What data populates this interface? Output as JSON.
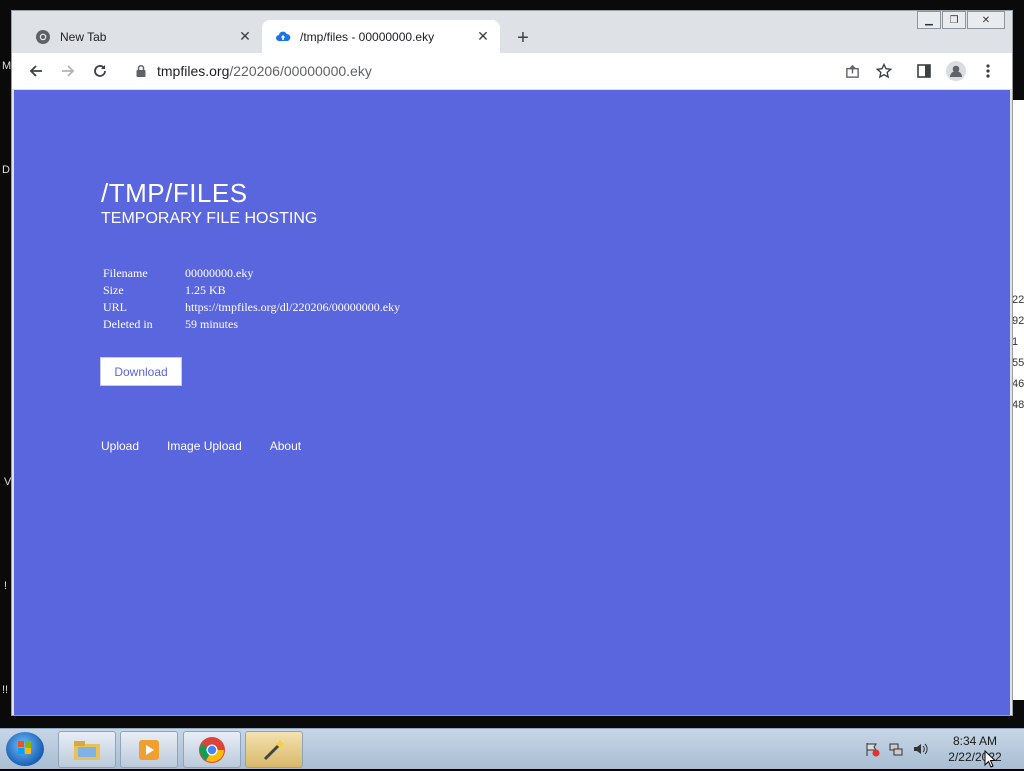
{
  "browser": {
    "tabs": [
      {
        "title": "New Tab",
        "icon": "chrome-icon"
      },
      {
        "title": "/tmp/files - 00000000.eky",
        "icon": "cloud-upload-icon",
        "active": true
      }
    ],
    "url_host": "tmpfiles.org",
    "url_path": "/220206/00000000.eky"
  },
  "page": {
    "site_title": "/TMP/FILES",
    "site_subtitle": "TEMPORARY FILE HOSTING",
    "info": [
      {
        "label": "Filename",
        "value": "00000000.eky"
      },
      {
        "label": "Size",
        "value": "1.25 KB"
      },
      {
        "label": "URL",
        "value": "https://tmpfiles.org/dl/220206/00000000.eky"
      },
      {
        "label": "Deleted in",
        "value": "59 minutes"
      }
    ],
    "download_label": "Download",
    "links": [
      "Upload",
      "Image Upload",
      "About"
    ],
    "background_color": "#5966de"
  },
  "desktop": {
    "left_fragments": [
      "M",
      "D",
      "V",
      "!",
      "!!"
    ],
    "right_fragments": [
      "22",
      "92",
      "1",
      "55",
      "46",
      "48"
    ]
  },
  "taskbar": {
    "time": "8:34 AM",
    "date": "2/22/2022"
  }
}
